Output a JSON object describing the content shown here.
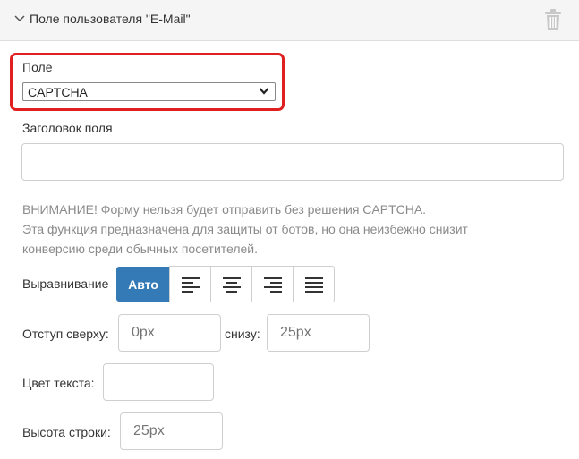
{
  "panel": {
    "title": "Поле пользователя \"E-Mail\"",
    "icons": {
      "collapse": "chevron-down-icon",
      "delete": "trash-icon"
    }
  },
  "field": {
    "label": "Поле",
    "selected": "CAPTCHA",
    "highlight_color": "#e02020"
  },
  "field_title": {
    "label": "Заголовок поля",
    "value": ""
  },
  "warning": {
    "lines": [
      "ВНИМАНИЕ! Форму нельзя будет отправить без решения CAPTCHA.",
      "Эта функция предназначена для защиты от ботов, но она неизбежно снизит",
      "конверсию среди обычных посетителей."
    ]
  },
  "alignment": {
    "label": "Выравнивание",
    "auto_label": "Авто",
    "active": "auto",
    "active_color": "#337ab7",
    "options": [
      "align-left-icon",
      "align-center-icon",
      "align-right-icon",
      "align-justify-icon"
    ]
  },
  "padding": {
    "top_label": "Отступ сверху:",
    "top_placeholder": "0px",
    "bottom_label": "снизу:",
    "bottom_placeholder": "25px"
  },
  "text_color": {
    "label": "Цвет текста:",
    "value": ""
  },
  "line_height": {
    "label": "Высота строки:",
    "placeholder": "25px"
  }
}
